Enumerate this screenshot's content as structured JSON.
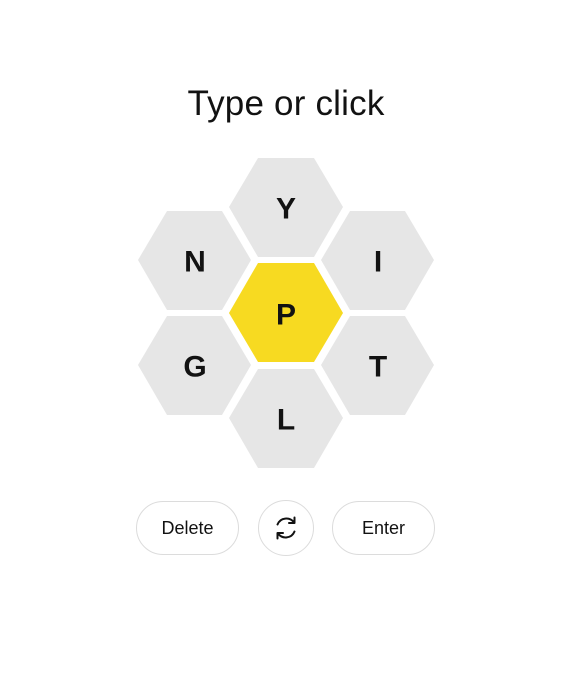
{
  "prompt": "Type or click",
  "hive": {
    "center_letter": "P",
    "outer_letters": [
      "Y",
      "I",
      "T",
      "L",
      "G",
      "N"
    ],
    "center_color": "#f7da21",
    "outer_color": "#e6e6e6"
  },
  "controls": {
    "delete_label": "Delete",
    "shuffle_icon": "shuffle-icon",
    "enter_label": "Enter"
  }
}
